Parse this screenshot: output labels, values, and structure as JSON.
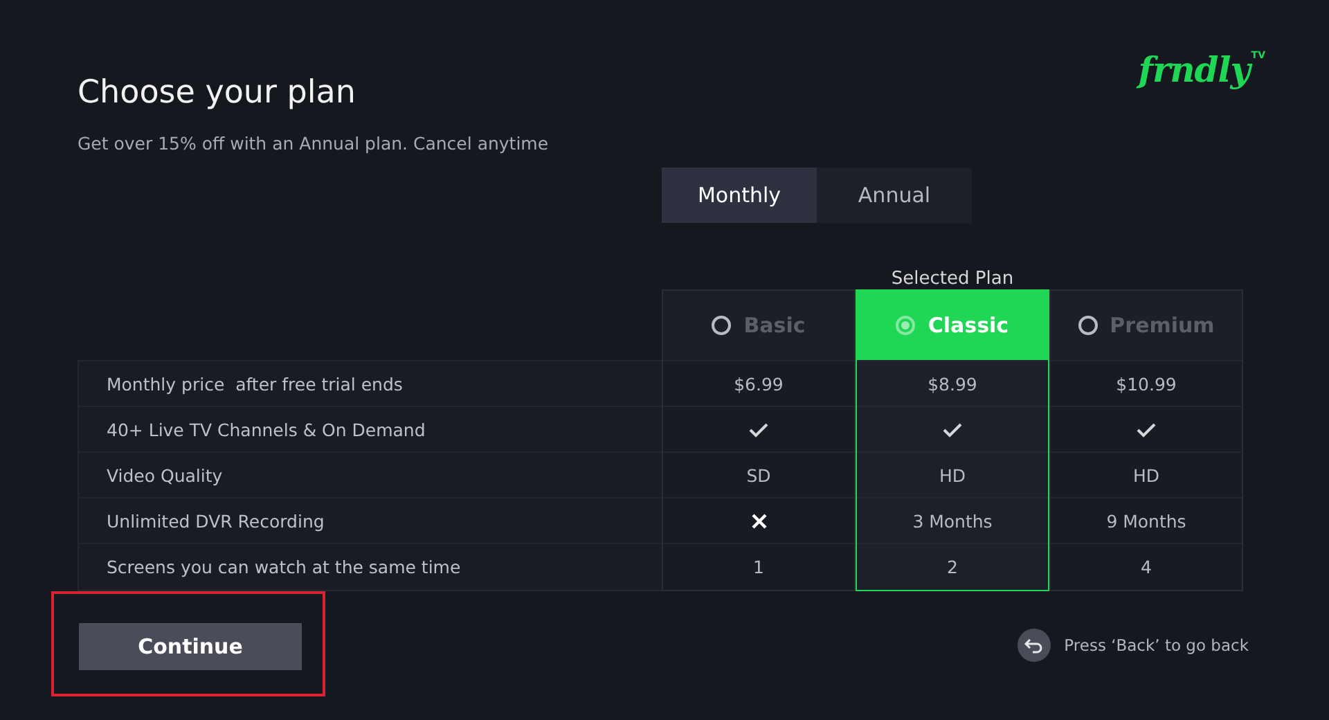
{
  "logo": {
    "name": "frndly",
    "badge": "TV"
  },
  "title": "Choose your plan",
  "subtitle": "Get over 15% off with an Annual plan. Cancel anytime",
  "tabs": [
    {
      "label": "Monthly",
      "selected": true
    },
    {
      "label": "Annual",
      "selected": false
    }
  ],
  "selected_label": "Selected Plan",
  "features": [
    "Monthly price  after free trial ends",
    "40+ Live TV Channels & On Demand",
    "Video Quality",
    "Unlimited DVR Recording",
    "Screens you can watch at the same time"
  ],
  "plans": [
    {
      "name": "Basic",
      "selected": false,
      "cells": [
        {
          "kind": "text",
          "text": "$6.99"
        },
        {
          "kind": "check"
        },
        {
          "kind": "text",
          "text": "SD"
        },
        {
          "kind": "cross"
        },
        {
          "kind": "text",
          "text": "1"
        }
      ]
    },
    {
      "name": "Classic",
      "selected": true,
      "cells": [
        {
          "kind": "text",
          "text": "$8.99"
        },
        {
          "kind": "check"
        },
        {
          "kind": "text",
          "text": "HD"
        },
        {
          "kind": "text",
          "text": "3 Months"
        },
        {
          "kind": "text",
          "text": "2"
        }
      ]
    },
    {
      "name": "Premium",
      "selected": false,
      "cells": [
        {
          "kind": "text",
          "text": "$10.99"
        },
        {
          "kind": "check"
        },
        {
          "kind": "text",
          "text": "HD"
        },
        {
          "kind": "text",
          "text": "9 Months"
        },
        {
          "kind": "text",
          "text": "4"
        }
      ]
    }
  ],
  "continue_button": {
    "label": "Continue",
    "highlighted": true
  },
  "back_hint": "Press ‘Back’ to go back"
}
